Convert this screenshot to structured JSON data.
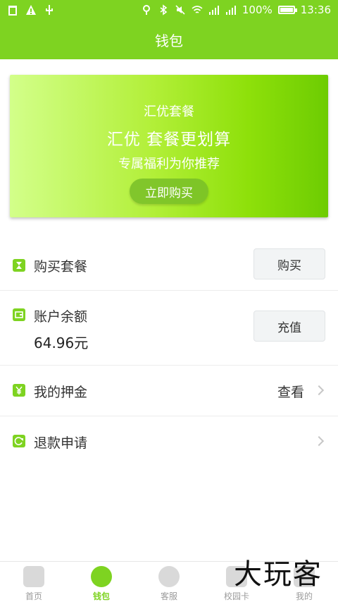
{
  "status_bar": {
    "battery": "100%",
    "time": "13:36",
    "left_icons": [
      "trash-icon",
      "warning-icon",
      "usb-icon"
    ],
    "right_icons": [
      "location-icon",
      "bluetooth-icon",
      "mute-icon",
      "wifi-icon",
      "signal-icon",
      "signal-icon",
      "battery-icon"
    ]
  },
  "header": {
    "title": "钱包"
  },
  "banner": {
    "line1": "汇优套餐",
    "line2": "汇优 套餐更划算",
    "line3": "专属福利为你推荐",
    "button": "立即购买"
  },
  "rows": {
    "package": {
      "label": "购买套餐",
      "button": "购买",
      "icon": "hourglass-icon"
    },
    "balance": {
      "label": "账户余额",
      "amount": "64.96元",
      "button": "充值",
      "icon": "wallet-icon"
    },
    "deposit": {
      "label": "我的押金",
      "link": "查看",
      "icon": "yen-icon"
    },
    "refund": {
      "label": "退款申请",
      "icon": "refresh-icon"
    }
  },
  "tabbar": {
    "tabs": [
      {
        "label": "首页",
        "icon": "home-icon"
      },
      {
        "label": "钱包",
        "icon": "wallet-icon"
      },
      {
        "label": "客服",
        "icon": "headset-icon"
      },
      {
        "label": "校园卡",
        "icon": "card-icon"
      },
      {
        "label": "我的",
        "icon": "user-icon"
      }
    ],
    "active": "钱包"
  },
  "watermark": "大玩客",
  "colors": {
    "accent": "#7ed321"
  }
}
